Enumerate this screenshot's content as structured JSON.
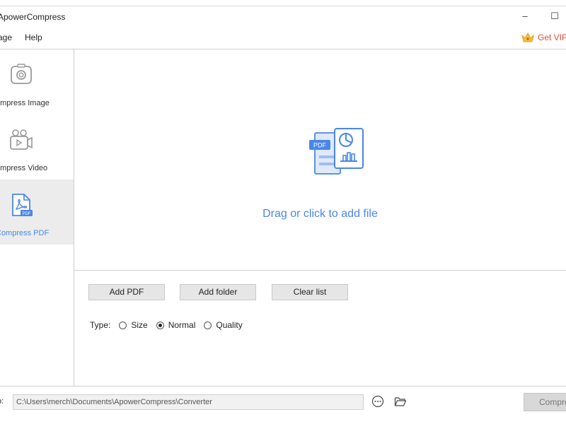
{
  "app": {
    "title": "ApowerCompress"
  },
  "window_controls": {
    "minimize": "–",
    "maximize": "☐"
  },
  "menu": {
    "items": [
      "age",
      "Help"
    ]
  },
  "vip": {
    "label": "Get VIP",
    "icon": "crown-icon",
    "color": "#e34a3a"
  },
  "sidebar": {
    "items": [
      {
        "label": "ompress Image",
        "icon": "camera-icon",
        "active": false
      },
      {
        "label": "ompress Video",
        "icon": "video-camera-icon",
        "active": false
      },
      {
        "label": "Compress PDF",
        "icon": "pdf-file-icon",
        "active": true
      }
    ]
  },
  "dropzone": {
    "text": "Drag or click to add file",
    "icon": "pdf-document-illustration"
  },
  "buttons": {
    "add_pdf": "Add PDF",
    "add_folder": "Add folder",
    "clear_list": "Clear list"
  },
  "type": {
    "label": "Type:",
    "options": [
      {
        "label": "Size",
        "checked": false
      },
      {
        "label": "Normal",
        "checked": true
      },
      {
        "label": "Quality",
        "checked": false
      }
    ]
  },
  "output": {
    "label": "o:",
    "path": "C:\\Users\\merch\\Documents\\ApowerCompress\\Converter",
    "more_icon": "ellipsis-circle-icon",
    "folder_icon": "folder-open-icon"
  },
  "compress_button": {
    "label": "Compress"
  },
  "colors": {
    "accent": "#4a86e8",
    "vip": "#e34a3a"
  }
}
